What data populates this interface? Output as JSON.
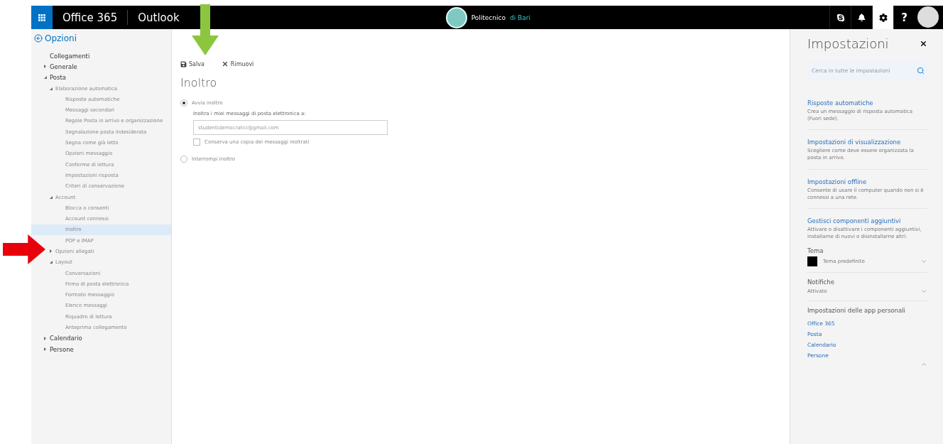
{
  "top_bar": {
    "app_suite": "Office 365",
    "app_name": "Outlook",
    "brand_name": "Politecnico",
    "brand_suffix": "di Bari",
    "icons": [
      {
        "kind": "skype",
        "selected": false
      },
      {
        "kind": "bell",
        "selected": false
      },
      {
        "kind": "gear",
        "selected": true
      },
      {
        "kind": "help",
        "label": "?",
        "selected": false
      }
    ]
  },
  "sidebar": {
    "back_label": "Opzioni",
    "items": [
      {
        "label": "Collegamenti",
        "selected": false
      },
      {
        "label": "Generale",
        "selected": false,
        "expanded": false
      },
      {
        "label": "Posta",
        "selected": false,
        "expanded": true,
        "children": [
          {
            "label": "Elaborazione automatica",
            "selected": false,
            "expanded": true,
            "children": [
              {
                "label": "Risposte automatiche",
                "selected": false
              },
              {
                "label": "Messaggi secondari",
                "selected": false
              },
              {
                "label": "Regole Posta in arrivo e organizzazione",
                "selected": false
              },
              {
                "label": "Segnalazione posta indesiderata",
                "selected": false
              },
              {
                "label": "Segna come già letto",
                "selected": false
              },
              {
                "label": "Opzioni messaggio",
                "selected": false
              },
              {
                "label": "Conferme di lettura",
                "selected": false
              },
              {
                "label": "Impostazioni risposta",
                "selected": false
              },
              {
                "label": "Criteri di conservazione",
                "selected": false
              }
            ]
          },
          {
            "label": "Account",
            "selected": false,
            "expanded": true,
            "children": [
              {
                "label": "Blocca o consenti",
                "selected": false
              },
              {
                "label": "Account connessi",
                "selected": false
              },
              {
                "label": "Inoltro",
                "selected": true
              },
              {
                "label": "POP e IMAP",
                "selected": false
              }
            ]
          },
          {
            "label": "Opzioni allegati",
            "selected": false,
            "expanded": false
          },
          {
            "label": "Layout",
            "selected": false,
            "expanded": true,
            "children": [
              {
                "label": "Conversazioni",
                "selected": false
              },
              {
                "label": "Firma di posta elettronica",
                "selected": false
              },
              {
                "label": "Formato messaggio",
                "selected": false
              },
              {
                "label": "Elenco messaggi",
                "selected": false
              },
              {
                "label": "Riquadro di lettura",
                "selected": false
              },
              {
                "label": "Anteprima collegamento",
                "selected": false
              }
            ]
          }
        ]
      },
      {
        "label": "Calendario",
        "selected": false,
        "expanded": false
      },
      {
        "label": "Persone",
        "selected": false,
        "expanded": false
      }
    ]
  },
  "toolbar": {
    "buttons": [
      {
        "kind": "save",
        "label": "Salva"
      },
      {
        "kind": "remove",
        "label": "Rimuovi"
      }
    ]
  },
  "form": {
    "title": "Inoltro",
    "options": [
      {
        "label": "Avvia inoltro",
        "selected": true
      },
      {
        "label": "Interrompi inoltro",
        "selected": false
      }
    ],
    "forward_label": "Inoltra i miei messaggi di posta elettronica a:",
    "forward_value": "studentidemocratici@gmail.com",
    "keep_copy": {
      "label": "Conserva una copia dei messaggi inoltrati",
      "checked": false
    }
  },
  "settings_panel": {
    "title": "Impostazioni",
    "search_placeholder": "Cerca in tutte le impostazioni",
    "sections": [
      {
        "title": "Risposte automatiche",
        "description": "Crea un messaggio di risposta automatica (Fuori sede)."
      },
      {
        "title": "Impostazioni di visualizzazione",
        "description": "Scegliere come deve essere organizzata la posta in arrivo."
      },
      {
        "title": "Impostazioni offline",
        "description": "Consente di usare il computer quando non si è connessi a una rete."
      },
      {
        "title": "Gestisci componenti aggiuntivi",
        "description": "Attivare o disattivare i componenti aggiuntivi, installarne di nuovi o disinstallarne altri."
      }
    ],
    "theme": {
      "heading": "Tema",
      "value": "Tema predefinito",
      "color": "#000000"
    },
    "notifications": {
      "heading": "Notifiche",
      "value": "Attivato"
    },
    "app_settings": {
      "heading": "Impostazioni delle app personali",
      "links": [
        "Office 365",
        "Posta",
        "Calendario",
        "Persone"
      ]
    }
  }
}
